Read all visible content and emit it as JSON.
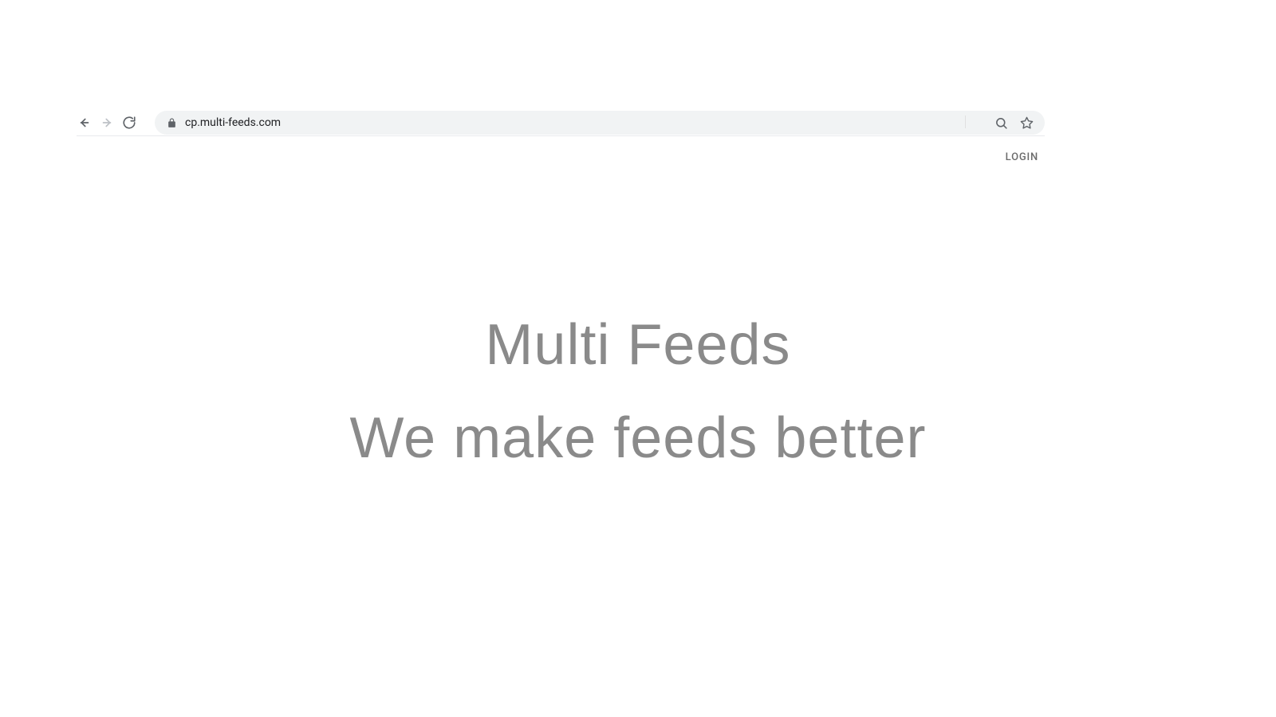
{
  "browser": {
    "url": "cp.multi-feeds.com"
  },
  "nav": {
    "login_label": "LOGIN"
  },
  "hero": {
    "title": "Multi Feeds",
    "subtitle": "We make feeds better"
  }
}
